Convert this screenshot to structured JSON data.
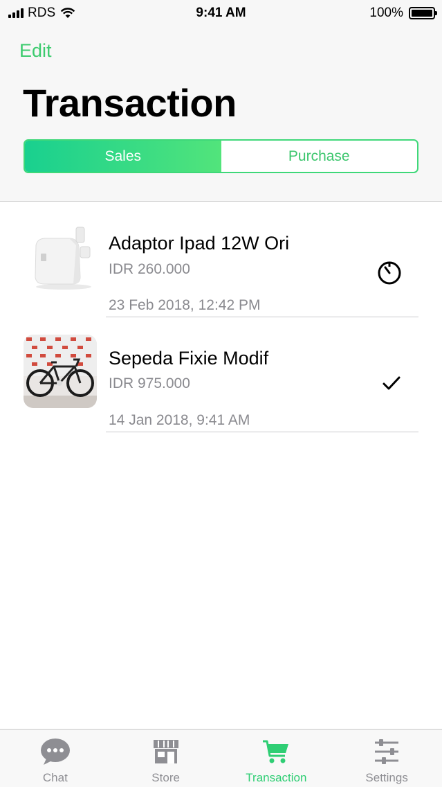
{
  "status_bar": {
    "carrier": "RDS",
    "time": "9:41 AM",
    "battery": "100%",
    "battery_level": 1.0
  },
  "header": {
    "edit_label": "Edit",
    "title": "Transaction"
  },
  "segments": {
    "sales": "Sales",
    "purchase": "Purchase",
    "selected": "Sales"
  },
  "transactions": [
    {
      "name": "Adaptor Ipad 12W Ori",
      "price": "IDR 260.000",
      "date": "23 Feb 2018, 12:42 PM",
      "status_icon": "timer-icon"
    },
    {
      "name": "Sepeda Fixie Modif",
      "price": "IDR 975.000",
      "date": "14 Jan 2018, 9:41 AM",
      "status_icon": "checkmark-icon"
    }
  ],
  "tabs": [
    {
      "label": "Chat",
      "icon": "chat-bubble-icon"
    },
    {
      "label": "Store",
      "icon": "store-icon"
    },
    {
      "label": "Transaction",
      "icon": "cart-icon"
    },
    {
      "label": "Settings",
      "icon": "sliders-icon"
    }
  ],
  "colors": {
    "accent": "#3ccb6e",
    "gradient_start": "#19d08f",
    "gradient_end": "#52e47b",
    "secondary_text": "#8a8a8f",
    "tab_inactive": "#8e8e93"
  }
}
